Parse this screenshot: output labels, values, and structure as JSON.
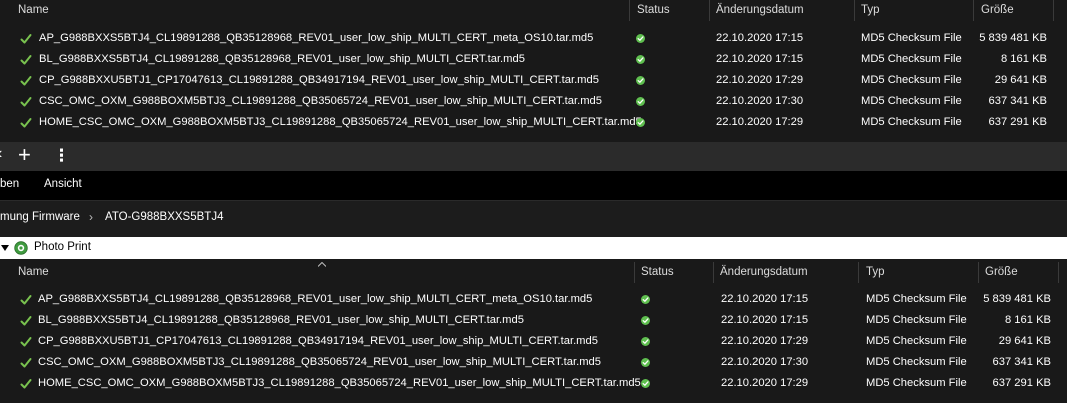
{
  "columns": {
    "name": "Name",
    "status": "Status",
    "date": "Änderungsdatum",
    "type": "Typ",
    "size": "Größe"
  },
  "files": [
    {
      "name": "AP_G988BXXS5BTJ4_CL19891288_QB35128968_REV01_user_low_ship_MULTI_CERT_meta_OS10.tar.md5",
      "date": "22.10.2020 17:15",
      "type": "MD5 Checksum File",
      "size": "5 839 481 KB"
    },
    {
      "name": "BL_G988BXXS5BTJ4_CL19891288_QB35128968_REV01_user_low_ship_MULTI_CERT.tar.md5",
      "date": "22.10.2020 17:15",
      "type": "MD5 Checksum File",
      "size": "8 161 KB"
    },
    {
      "name": "CP_G988BXXU5BTJ1_CP17047613_CL19891288_QB34917194_REV01_user_low_ship_MULTI_CERT.tar.md5",
      "date": "22.10.2020 17:29",
      "type": "MD5 Checksum File",
      "size": "29 641 KB"
    },
    {
      "name": "CSC_OMC_OXM_G988BOXM5BTJ3_CL19891288_QB35065724_REV01_user_low_ship_MULTI_CERT.tar.md5",
      "date": "22.10.2020 17:30",
      "type": "MD5 Checksum File",
      "size": "637 341 KB"
    },
    {
      "name": "HOME_CSC_OMC_OXM_G988BOXM5BTJ3_CL19891288_QB35065724_REV01_user_low_ship_MULTI_CERT.tar.md5",
      "date": "22.10.2020 17:29",
      "type": "MD5 Checksum File",
      "size": "637 291 KB"
    }
  ],
  "toolbar": {
    "new_tab": "+",
    "more": "⋮",
    "close_partial": "‹"
  },
  "ribbon": {
    "open_partial": "ben",
    "view": "Ansicht"
  },
  "breadcrumb": {
    "parent": "mung Firmware",
    "separator": "›",
    "current": "ATO-G988BXXS5BTJ4"
  },
  "group": {
    "label": "Photo Print"
  },
  "colors": {
    "status_ok": "#5fbf4f",
    "check": "#79c24f",
    "background": "#191919"
  },
  "icons": {
    "file_check": "check-mark-icon",
    "status": "green-status-icon",
    "group": "photo-print-icon"
  }
}
